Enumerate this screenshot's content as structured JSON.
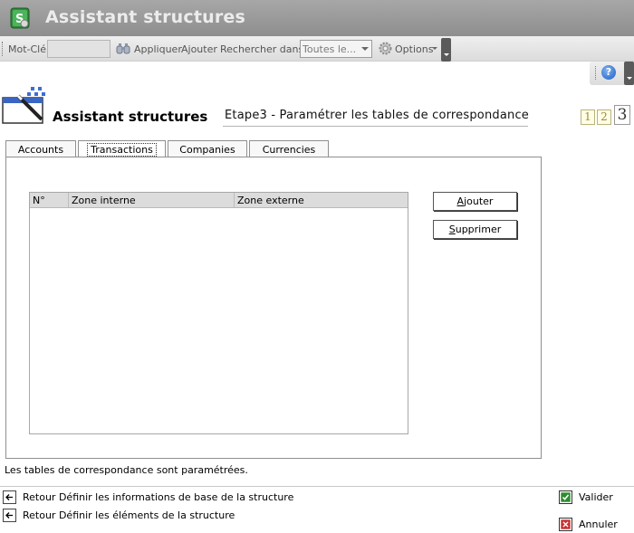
{
  "window": {
    "title": "Assistant structures"
  },
  "toolbar": {
    "keyword_label": "Mot-Clé",
    "keyword_value": "",
    "apply_label": "Appliquer",
    "add_label": "Ajouter",
    "search_in_label": "Rechercher dans",
    "search_in_value": "Toutes le...",
    "options_label": "Options"
  },
  "header": {
    "title": "Assistant structures",
    "step_text": "Etape3 - Paramétrer les tables de correspondance",
    "steps": [
      "1",
      "2",
      "3"
    ],
    "current_step": "3"
  },
  "tabs": [
    {
      "label": "Accounts"
    },
    {
      "label": "Transactions",
      "active": true
    },
    {
      "label": "Companies"
    },
    {
      "label": "Currencies"
    }
  ],
  "grid": {
    "columns": [
      "N°",
      "Zone interne",
      "Zone externe"
    ],
    "rows": []
  },
  "buttons": {
    "add_prefix": "A",
    "add_rest": "jouter",
    "remove_prefix": "S",
    "remove_rest": "upprimer"
  },
  "status": {
    "message": "Les tables de correspondance sont paramétrées."
  },
  "footer": {
    "back_links": [
      "Retour Définir les informations de base de la structure",
      "Retour Définir les éléments de la structure"
    ],
    "validate_label": "Valider",
    "cancel_label": "Annuler"
  },
  "colors": {
    "validate": "#2f8a2f",
    "cancel": "#c83232",
    "title_bar": "#9b9b9b"
  }
}
